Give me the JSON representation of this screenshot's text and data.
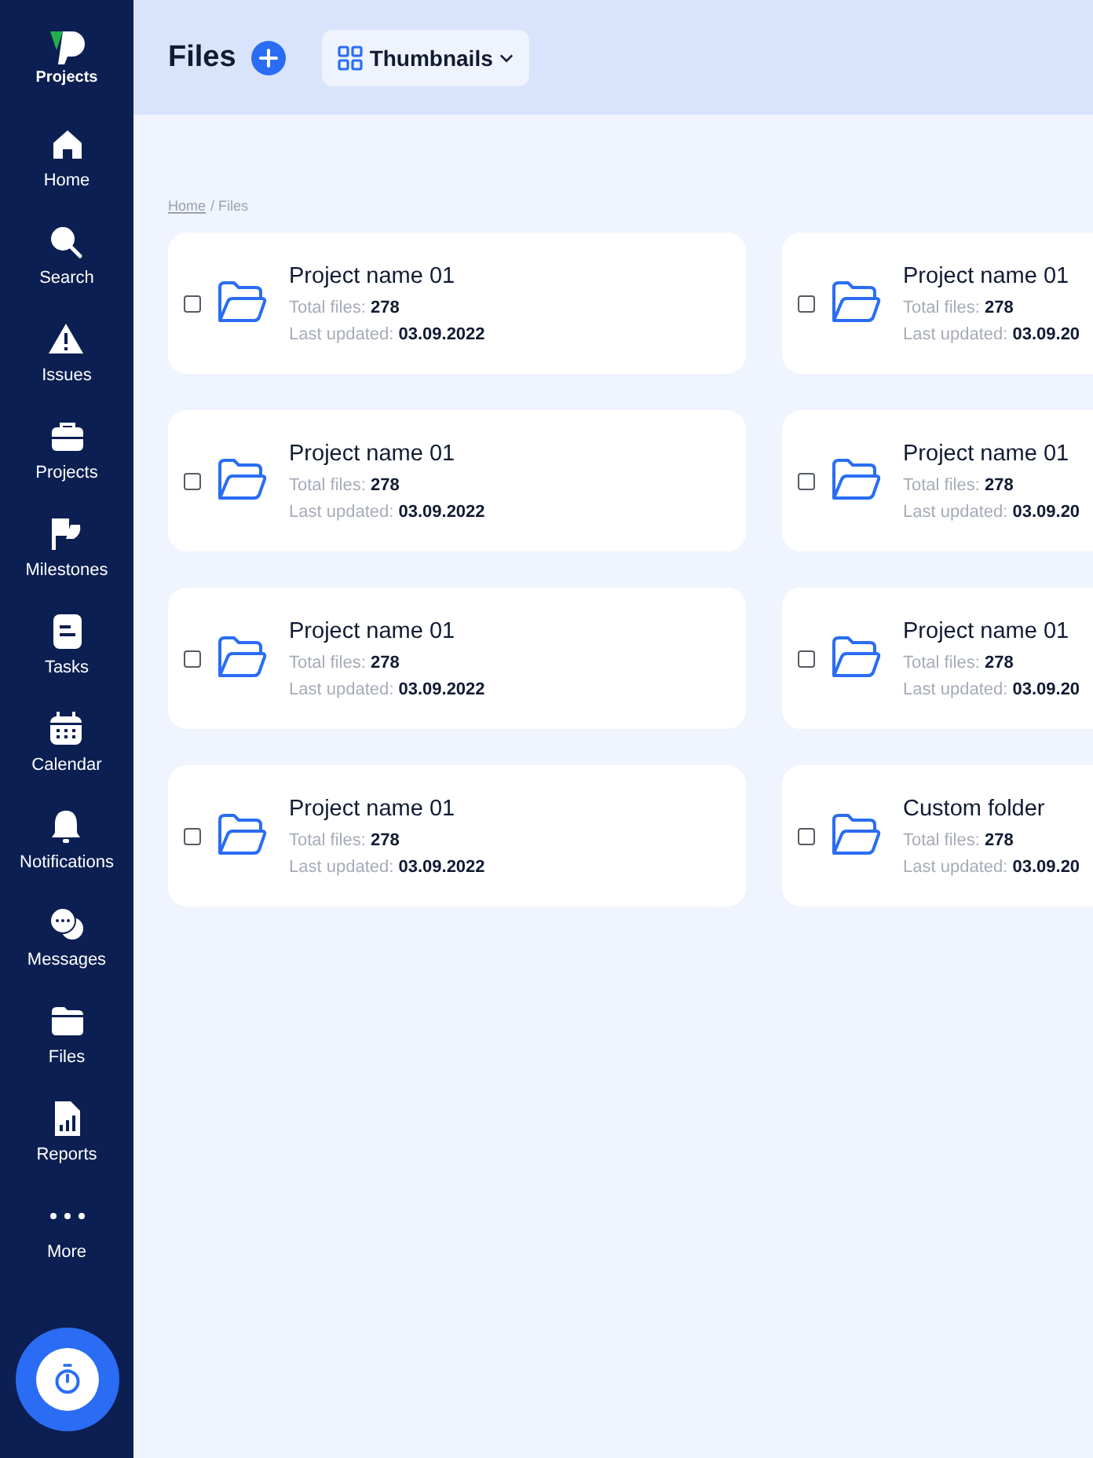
{
  "sidebar": {
    "logo_label": "Projects",
    "items": [
      {
        "kind": "home",
        "label": "Home"
      },
      {
        "kind": "search",
        "label": "Search"
      },
      {
        "kind": "issues",
        "label": "Issues"
      },
      {
        "kind": "projects",
        "label": "Projects"
      },
      {
        "kind": "milestones",
        "label": "Milestones"
      },
      {
        "kind": "tasks",
        "label": "Tasks"
      },
      {
        "kind": "calendar",
        "label": "Calendar"
      },
      {
        "kind": "notifications",
        "label": "Notifications"
      },
      {
        "kind": "messages",
        "label": "Messages"
      },
      {
        "kind": "files",
        "label": "Files"
      },
      {
        "kind": "reports",
        "label": "Reports"
      },
      {
        "kind": "more",
        "label": "More"
      }
    ]
  },
  "header": {
    "title": "Files",
    "view_button": "Thumbnails"
  },
  "breadcrumb": [
    {
      "label": "Home",
      "link": true
    },
    {
      "label": "/ Files",
      "link": false
    }
  ],
  "folders": [
    {
      "name": "Project name 01",
      "files_label": "Total files:",
      "files": "278",
      "updated_label": "Last updated:",
      "updated": "03.09.2022",
      "checked": false
    },
    {
      "name": "Project name 01",
      "files_label": "Total files:",
      "files": "278",
      "updated_label": "Last updated:",
      "updated": "03.09.20",
      "checked": false
    },
    {
      "name": "Project name 01",
      "files_label": "Total files:",
      "files": "278",
      "updated_label": "Last updated:",
      "updated": "03.09.2022",
      "checked": false
    },
    {
      "name": "Project name 01",
      "files_label": "Total files:",
      "files": "278",
      "updated_label": "Last updated:",
      "updated": "03.09.20",
      "checked": false
    },
    {
      "name": "Project name 01",
      "files_label": "Total files:",
      "files": "278",
      "updated_label": "Last updated:",
      "updated": "03.09.2022",
      "checked": false
    },
    {
      "name": "Project name 01",
      "files_label": "Total files:",
      "files": "278",
      "updated_label": "Last updated:",
      "updated": "03.09.20",
      "checked": false
    },
    {
      "name": "Project name 01",
      "files_label": "Total files:",
      "files": "278",
      "updated_label": "Last updated:",
      "updated": "03.09.2022",
      "checked": false
    },
    {
      "name": "Custom folder",
      "files_label": "Total files:",
      "files": "278",
      "updated_label": "Last updated:",
      "updated": "03.09.20",
      "checked": false
    }
  ]
}
